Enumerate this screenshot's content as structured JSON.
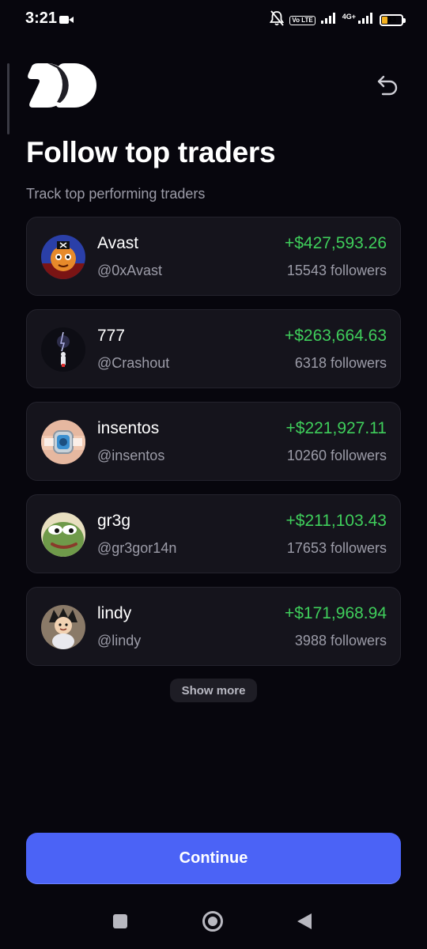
{
  "status_bar": {
    "time": "3:21",
    "volte": "Vo LTE",
    "network": "4G+",
    "battery_level": "33",
    "battery_color": "#f2b01e",
    "icons": [
      "video-camera-icon",
      "bell-off-icon",
      "signal-icon",
      "battery-icon"
    ]
  },
  "header": {
    "logo_icon": "app-logo-icon",
    "back_icon": "undo-arrow-icon"
  },
  "title": "Follow top traders",
  "subtitle": "Track top performing traders",
  "traders": [
    {
      "name": "Avast",
      "handle": "@0xAvast",
      "profit": "+$427,593.26",
      "followers": "15543 followers"
    },
    {
      "name": "777",
      "handle": "@Crashout",
      "profit": "+$263,664.63",
      "followers": "6318 followers"
    },
    {
      "name": "insentos",
      "handle": "@insentos",
      "profit": "+$221,927.11",
      "followers": "10260 followers"
    },
    {
      "name": "gr3g",
      "handle": "@gr3gor14n",
      "profit": "+$211,103.43",
      "followers": "17653 followers"
    },
    {
      "name": "lindy",
      "handle": "@lindy",
      "profit": "+$171,968.94",
      "followers": "3988 followers"
    }
  ],
  "show_more_label": "Show more",
  "continue_label": "Continue",
  "colors": {
    "background": "#07060d",
    "card": "#15141c",
    "profit": "#3fce5b",
    "accent": "#4b63f6"
  },
  "nav_bar": [
    "recents-square-icon",
    "home-circle-icon",
    "back-triangle-icon"
  ]
}
